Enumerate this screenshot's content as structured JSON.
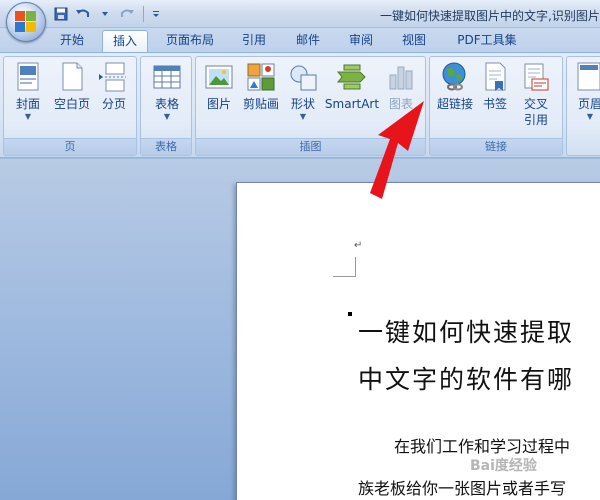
{
  "window": {
    "title": "一键如何快速提取图片中的文字,识别图片"
  },
  "quick_access": {
    "icons": [
      "save-icon",
      "undo-icon",
      "redo-icon",
      "customize-icon"
    ]
  },
  "tabs": [
    {
      "label": "开始"
    },
    {
      "label": "插入",
      "active": true
    },
    {
      "label": "页面布局"
    },
    {
      "label": "引用"
    },
    {
      "label": "邮件"
    },
    {
      "label": "审阅"
    },
    {
      "label": "视图"
    },
    {
      "label": "PDF工具集"
    }
  ],
  "ribbon": {
    "groups": [
      {
        "label": "页",
        "buttons": [
          {
            "label": "封面"
          },
          {
            "label": "空白页"
          },
          {
            "label": "分页"
          }
        ]
      },
      {
        "label": "表格",
        "buttons": [
          {
            "label": "表格"
          }
        ]
      },
      {
        "label": "插图",
        "buttons": [
          {
            "label": "图片"
          },
          {
            "label": "剪贴画"
          },
          {
            "label": "形状"
          },
          {
            "label": "SmartArt"
          },
          {
            "label": "图表"
          }
        ]
      },
      {
        "label": "链接",
        "buttons": [
          {
            "label": "超链接"
          },
          {
            "label": "书签"
          },
          {
            "label": "交叉"
          },
          {
            "label": "引用"
          }
        ]
      },
      {
        "label": "",
        "buttons": [
          {
            "label": "页眉"
          }
        ]
      }
    ]
  },
  "document": {
    "title_line1": "一键如何快速提取",
    "title_line2": "中文字的软件有哪",
    "body_line1": "在我们工作和学习过程中",
    "body_line2": "族老板给你一张图片或者手写"
  },
  "watermark": "Bai度经验",
  "colors": {
    "ribbon_text": "#15428b",
    "arrow": "#e8141b"
  }
}
